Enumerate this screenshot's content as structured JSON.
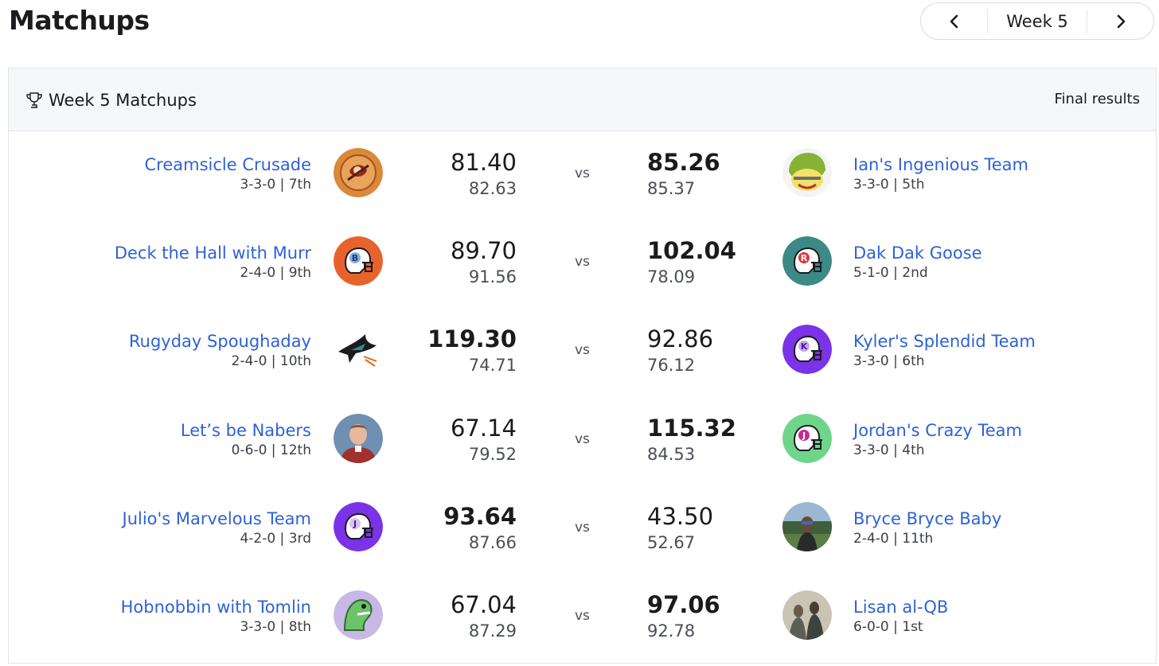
{
  "page": {
    "title": "Matchups"
  },
  "week_nav": {
    "label": "Week 5"
  },
  "panel": {
    "title": "Week 5 Matchups",
    "status": "Final results",
    "vs_label": "vs"
  },
  "matchups": [
    {
      "left": {
        "name": "Creamsicle Crusade",
        "record": "3-3-0 | 7th",
        "score": "81.40",
        "projected": "82.63",
        "avatar": "buccaneer-logo",
        "winner": false
      },
      "right": {
        "name": "Ian's Ingenious Team",
        "record": "3-3-0 | 5th",
        "score": "85.26",
        "projected": "85.37",
        "avatar": "yellow-helmet-face",
        "winner": true
      }
    },
    {
      "left": {
        "name": "Deck the Hall with Murr",
        "record": "2-4-0 | 9th",
        "score": "89.70",
        "projected": "91.56",
        "avatar": "helmet-b",
        "winner": false
      },
      "right": {
        "name": "Dak Dak Goose",
        "record": "5-1-0 | 2nd",
        "score": "102.04",
        "projected": "78.09",
        "avatar": "helmet-r",
        "winner": true
      }
    },
    {
      "left": {
        "name": "Rugyday Spoughaday",
        "record": "2-4-0 | 10th",
        "score": "119.30",
        "projected": "74.71",
        "avatar": "shark-logo",
        "winner": true
      },
      "right": {
        "name": "Kyler's Splendid Team",
        "record": "3-3-0 | 6th",
        "score": "92.86",
        "projected": "76.12",
        "avatar": "helmet-k",
        "winner": false
      }
    },
    {
      "left": {
        "name": "Let’s be Nabers",
        "record": "0-6-0 | 12th",
        "score": "67.14",
        "projected": "79.52",
        "avatar": "person-photo",
        "winner": false
      },
      "right": {
        "name": "Jordan's Crazy Team",
        "record": "3-3-0 | 4th",
        "score": "115.32",
        "projected": "84.53",
        "avatar": "helmet-j-green",
        "winner": true
      }
    },
    {
      "left": {
        "name": "Julio's Marvelous Team",
        "record": "4-2-0 | 3rd",
        "score": "93.64",
        "projected": "87.66",
        "avatar": "helmet-j-purple",
        "winner": true
      },
      "right": {
        "name": "Bryce Bryce Baby",
        "record": "2-4-0 | 11th",
        "score": "43.50",
        "projected": "52.67",
        "avatar": "person-photo-outdoor",
        "winner": false
      }
    },
    {
      "left": {
        "name": "Hobnobbin with Tomlin",
        "record": "3-3-0 | 8th",
        "score": "67.04",
        "projected": "87.29",
        "avatar": "dinosaur-cartoon",
        "winner": false
      },
      "right": {
        "name": "Lisan al-QB",
        "record": "6-0-0 | 1st",
        "score": "97.06",
        "projected": "92.78",
        "avatar": "group-photo",
        "winner": true
      }
    }
  ]
}
